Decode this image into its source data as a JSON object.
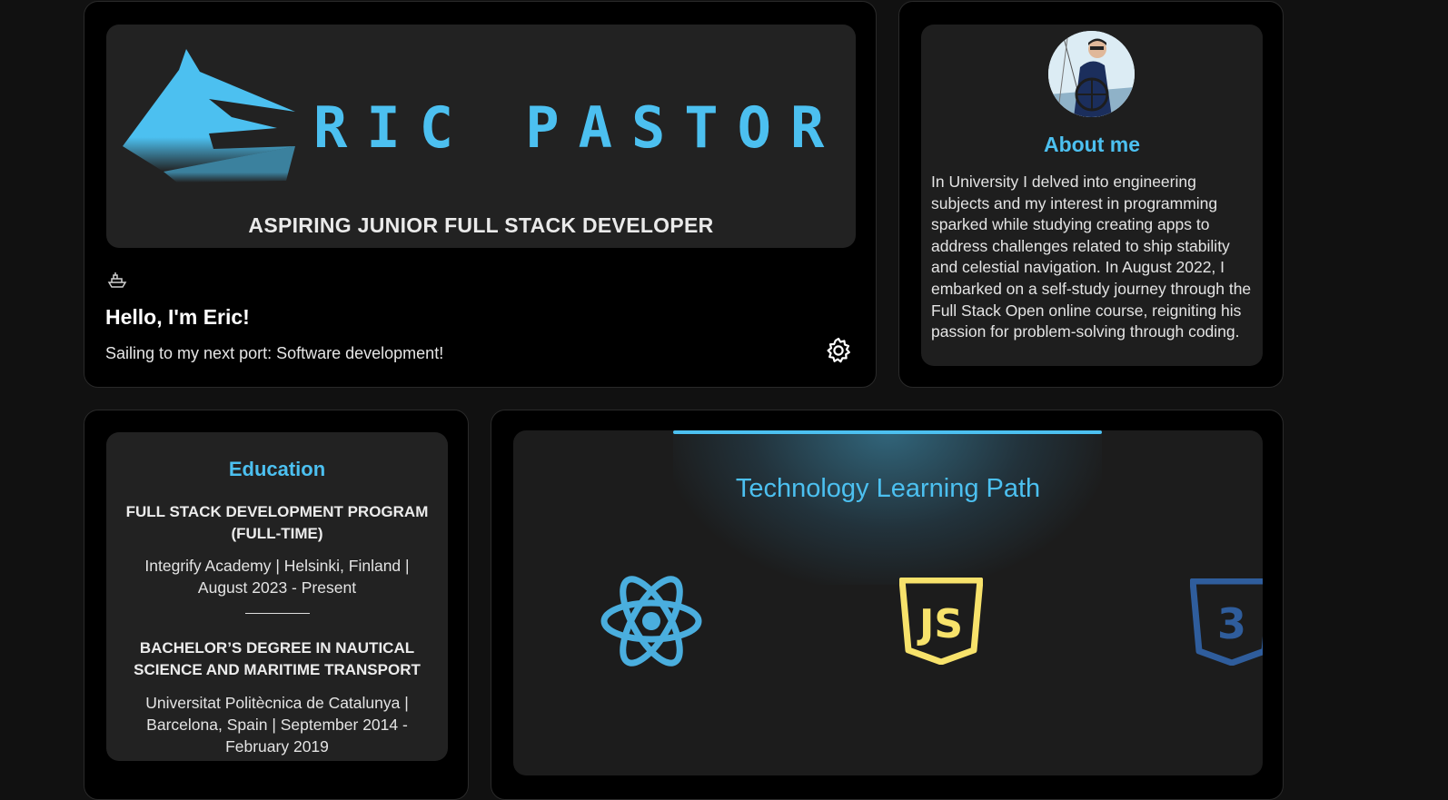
{
  "hero": {
    "logo_text": "RIC PASTOR",
    "subtitle": "ASPIRING JUNIOR FULL STACK DEVELOPER",
    "greeting": "Hello, I'm Eric!",
    "tagline": "Sailing to my next port: Software development!",
    "icons": [
      "ship-icon",
      "gear-icon"
    ],
    "accent_color": "#4cc0f0"
  },
  "about": {
    "title": "About me",
    "text": "In University I delved into engineering subjects and my interest in programming sparked while studying creating apps to address challenges related to ship stability and celestial navigation. In August 2022, I embarked on a self-study journey through the Full Stack Open online course, reigniting his passion for problem-solving through coding."
  },
  "education": {
    "title": "Education",
    "entries": [
      {
        "degree": "FULL STACK DEVELOPMENT PROGRAM (FULL-TIME)",
        "detail": "Integrify Academy | Helsinki, Finland | August 2023 - Present"
      },
      {
        "degree": "BACHELOR’S DEGREE IN NAUTICAL SCIENCE AND MARITIME TRANSPORT",
        "detail": "Universitat Politècnica de Catalunya | Barcelona, Spain | September 2014 - February 2019"
      }
    ]
  },
  "tech": {
    "title": "Technology Learning Path",
    "logos": [
      {
        "name": "react-icon",
        "color": "#4aaede"
      },
      {
        "name": "javascript-icon",
        "color": "#f7e26b",
        "text": "JS"
      },
      {
        "name": "css3-icon",
        "color": "#2f5d9c",
        "text": "3"
      }
    ]
  }
}
